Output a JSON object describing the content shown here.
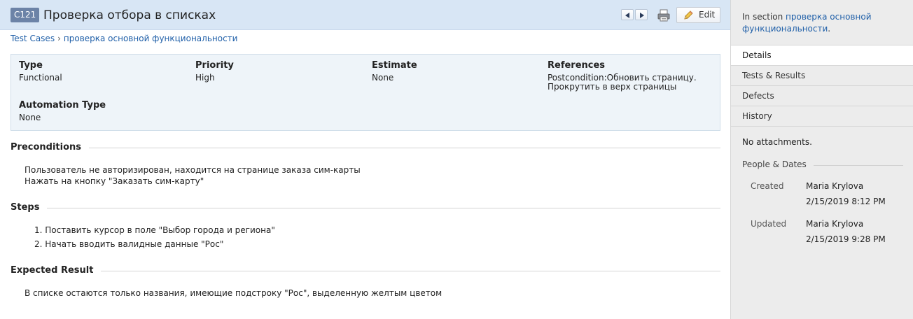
{
  "header": {
    "case_id": "C121",
    "title": "Проверка отбора в списках",
    "edit_label": "Edit"
  },
  "breadcrumb": {
    "root": "Test Cases",
    "separator": "›",
    "section": "проверка основной функциональности"
  },
  "fields": {
    "type": {
      "label": "Type",
      "value": "Functional"
    },
    "priority": {
      "label": "Priority",
      "value": "High"
    },
    "estimate": {
      "label": "Estimate",
      "value": "None"
    },
    "references": {
      "label": "References",
      "value_line1": "Postcondition:Обновить страницу.",
      "value_line2": "Прокрутить в верх страницы"
    },
    "automation_type": {
      "label": "Automation Type",
      "value": "None"
    }
  },
  "preconditions": {
    "title": "Preconditions",
    "lines": [
      "Пользователь не авторизирован, находится на странице заказа сим-карты",
      "Нажать на кнопку \"Заказать сим-карту\""
    ]
  },
  "steps": {
    "title": "Steps",
    "items": [
      "1. Поставить курсор в поле \"Выбор города и региона\"",
      "2. Начать вводить валидные данные \"Рос\""
    ]
  },
  "expected": {
    "title": "Expected Result",
    "text": "В списке остаются только названия, имеющие подстроку \"Рос\", выделенную желтым цветом"
  },
  "sidebar": {
    "section_prefix": "In section",
    "section_link_line1": "проверка основной",
    "section_link_line2": "функциональности",
    "section_suffix": ".",
    "tabs": [
      {
        "label": "Details",
        "active": true
      },
      {
        "label": "Tests & Results",
        "active": false
      },
      {
        "label": "Defects",
        "active": false
      },
      {
        "label": "History",
        "active": false
      }
    ],
    "no_attachments": "No attachments.",
    "people_dates_title": "People & Dates",
    "created": {
      "label": "Created",
      "user": "Maria Krylova",
      "date": "2/15/2019 8:12 PM"
    },
    "updated": {
      "label": "Updated",
      "user": "Maria Krylova",
      "date": "2/15/2019 9:28 PM"
    }
  },
  "colors": {
    "title_bar": "#d8e6f5",
    "case_badge": "#6c83a7",
    "link": "#1f5fa8",
    "fields_box": "#eef4f9",
    "sidebar_bg": "#ececec"
  },
  "icons": [
    "chevron-left-icon",
    "chevron-right-icon",
    "printer-icon",
    "pencil-icon"
  ]
}
